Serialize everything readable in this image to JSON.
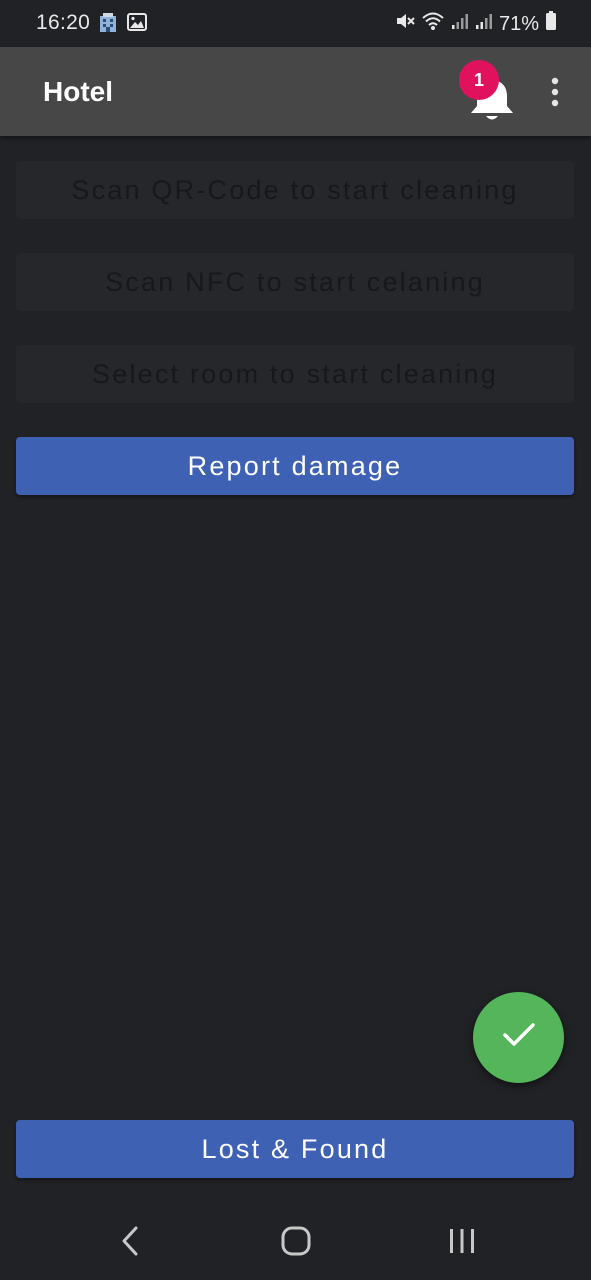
{
  "status_bar": {
    "time": "16:20",
    "battery": "71%",
    "left_icons": [
      "hotel-icon",
      "image-icon"
    ],
    "right_icons": [
      "mute-icon",
      "wifi-icon",
      "signal-icon",
      "signal-icon",
      "battery-icon"
    ]
  },
  "app_bar": {
    "title": "Hotel",
    "notification_count": "1"
  },
  "buttons": {
    "scan_qr": "Scan QR-Code to start cleaning",
    "scan_nfc": "Scan NFC to start celaning",
    "select_room": "Select room to start cleaning",
    "report_damage": "Report damage",
    "lost_found": "Lost & Found"
  },
  "colors": {
    "background": "#212226",
    "app_bar": "#474747",
    "primary_button": "#3f61b4",
    "badge": "#e0125e",
    "fab": "#55b55b"
  },
  "fab": {
    "icon": "check-icon"
  },
  "nav_bar": {
    "icons": [
      "back-icon",
      "home-icon",
      "recents-icon"
    ]
  }
}
